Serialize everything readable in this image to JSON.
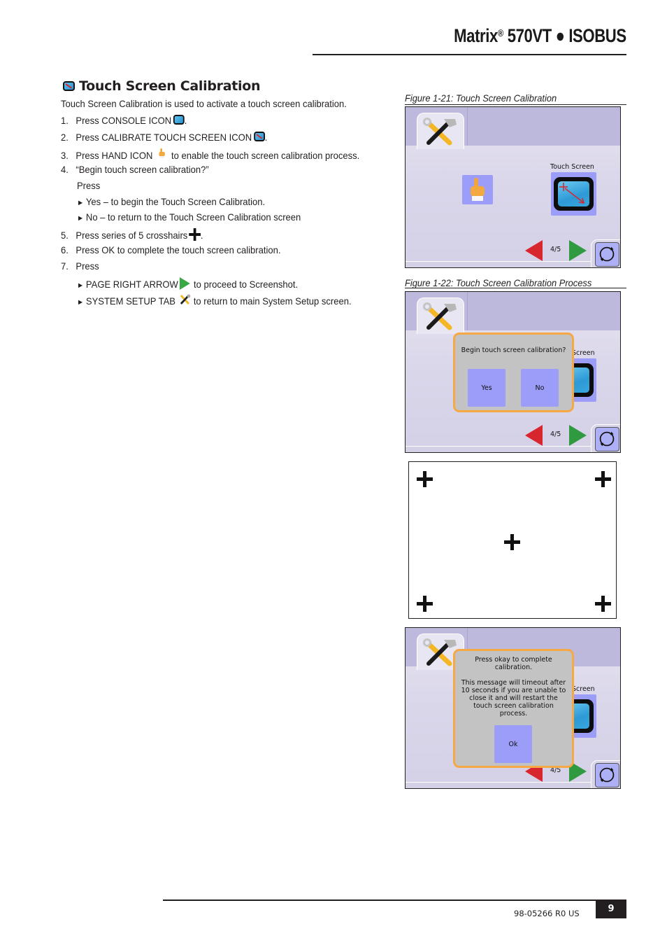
{
  "header": {
    "title_brand": "Matrix",
    "title_reg": "®",
    "title_rest": " 570VT ● ISOBUS"
  },
  "section": {
    "heading": "Touch Screen Calibration",
    "heading_icon": "calibrate-touch-screen-icon",
    "intro": "Touch Screen Calibration is used to activate a touch screen calibration.",
    "steps": [
      {
        "num": "1.",
        "text": "Press CONSOLE ICON",
        "after": ".",
        "icon": "console-icon"
      },
      {
        "num": "2.",
        "text": "Press CALIBRATE TOUCH SCREEN ICON",
        "after": ".",
        "icon": "calibrate-touch-screen-icon"
      },
      {
        "num": "3.",
        "text": "Press HAND ICON",
        "after": "  to enable the touch screen calibration process.",
        "icon": "hand-icon"
      },
      {
        "num": "4.",
        "text": "“Begin touch screen calibration?”"
      },
      {
        "num": "",
        "text": "Press"
      },
      {
        "num": "",
        "text": "Yes – to begin the Touch Screen Calibration.",
        "bullet": "►"
      },
      {
        "num": "",
        "text": "No – to return to the Touch Screen Calibration screen",
        "bullet": "►"
      },
      {
        "num": "5.",
        "text": "Press series of 5 crosshairs",
        "after": ".",
        "icon": "crosshair-icon"
      },
      {
        "num": "6.",
        "text": "Press OK to complete the touch screen calibration."
      },
      {
        "num": "7.",
        "text": "Press"
      },
      {
        "num": "",
        "text": "PAGE RIGHT ARROW",
        "after": " to proceed to Screenshot.",
        "bullet": "►",
        "icon": "page-right-arrow-icon"
      },
      {
        "num": "",
        "text": "SYSTEM SETUP TAB",
        "after": " to return to main System Setup screen.",
        "bullet": "►",
        "icon": "system-setup-tab-icon"
      }
    ]
  },
  "figures": [
    {
      "caption": "Figure 1-21: Touch Screen Calibration"
    },
    {
      "caption": "Figure 1-22: Touch Screen Calibration Process"
    }
  ],
  "device_screen": {
    "touch_screen_label": "Touch Screen",
    "touch_screen_label_partial": "Screen",
    "page_indicator": "4/5",
    "colors": {
      "topbar": "#bdb9dc",
      "button": "#9c9cf9",
      "dialog_bg": "#c3c3c3",
      "dialog_border": "#f5a843",
      "prev_arrow": "#d8262e",
      "next_arrow": "#2f9a3f"
    }
  },
  "dialog_begin": {
    "message": "Begin touch screen calibration?",
    "yes_label": "Yes",
    "no_label": "No"
  },
  "calibration_screen": {
    "crosshair_count": 5
  },
  "dialog_complete": {
    "line1": "Press okay to complete",
    "line2": "calibration.",
    "line3": "This message will timeout after",
    "line4": "10 seconds if you are unable to",
    "line5": "close it and will restart the",
    "line6": "touch screen calibration",
    "line7": "process.",
    "ok_label": "Ok"
  },
  "footer": {
    "doc_number": "98-05266 R0 US",
    "page_number": "9"
  }
}
